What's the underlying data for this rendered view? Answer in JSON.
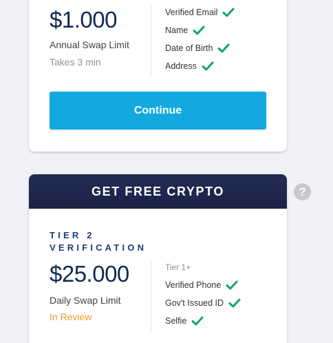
{
  "tier1": {
    "amount": "$1.000",
    "limit_label": "Annual Swap Limit",
    "status": "Takes 3 min",
    "requirements": [
      "Verified Email",
      "Name",
      "Date of Birth",
      "Address"
    ],
    "continue_label": "Continue"
  },
  "tier2": {
    "banner": "GET FREE CRYPTO",
    "title": "TIER 2 VERIFICATION",
    "amount": "$25.000",
    "limit_label": "Daily Swap Limit",
    "status": "In Review",
    "requirements_heading": "Tier 1+",
    "requirements": [
      "Verified Phone",
      "Gov't Issued ID",
      "Selfie"
    ]
  },
  "help": {
    "label": "?"
  },
  "colors": {
    "navy": "#0e2a52",
    "accent_blue": "#14a8e1",
    "check_green": "#12a36f",
    "review_orange": "#f29a2e",
    "muted_gray": "#8a8f99"
  },
  "icons": {
    "check": "checkmark-icon",
    "help": "question-circle-icon"
  }
}
